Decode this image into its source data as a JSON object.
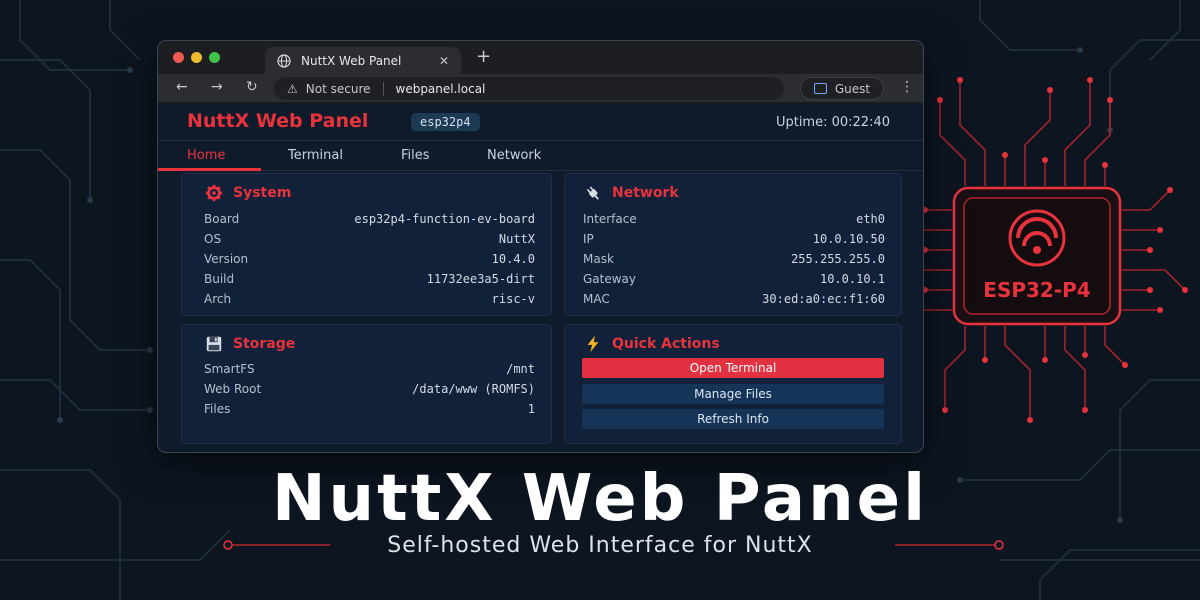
{
  "browser": {
    "tab_title": "NuttX Web Panel",
    "tab_close": "✕",
    "new_tab": "+",
    "nav": {
      "back": "←",
      "forward": "→",
      "reload": "↻"
    },
    "security_text": "Not secure",
    "url": "webpanel.local",
    "profile_label": "Guest",
    "menu": "⋮"
  },
  "app": {
    "title": "NuttX Web Panel",
    "board_chip": "esp32p4",
    "uptime": "Uptime: 00:22:40",
    "nav": [
      "Home",
      "Terminal",
      "Files",
      "Network"
    ],
    "active_nav": "Home"
  },
  "system": {
    "title": "System",
    "icon": "gear-icon",
    "rows": [
      {
        "k": "Board",
        "v": "esp32p4-function-ev-board"
      },
      {
        "k": "OS",
        "v": "NuttX"
      },
      {
        "k": "Version",
        "v": "10.4.0"
      },
      {
        "k": "Build",
        "v": "11732ee3a5-dirt"
      },
      {
        "k": "Arch",
        "v": "risc-v"
      }
    ]
  },
  "network": {
    "title": "Network",
    "icon": "plug-icon",
    "rows": [
      {
        "k": "Interface",
        "v": "eth0"
      },
      {
        "k": "IP",
        "v": "10.0.10.50"
      },
      {
        "k": "Mask",
        "v": "255.255.255.0"
      },
      {
        "k": "Gateway",
        "v": "10.0.10.1"
      },
      {
        "k": "MAC",
        "v": "30:ed:a0:ec:f1:60"
      }
    ]
  },
  "storage": {
    "title": "Storage",
    "icon": "floppy-disk-icon",
    "rows": [
      {
        "k": "SmartFS",
        "v": "/mnt"
      },
      {
        "k": "Web Root",
        "v": "/data/www (ROMFS)"
      },
      {
        "k": "Files",
        "v": "1"
      }
    ]
  },
  "quick_actions": {
    "title": "Quick Actions",
    "icon": "lightning-icon",
    "buttons": [
      "Open Terminal",
      "Manage Files",
      "Refresh Info"
    ]
  },
  "hero": {
    "title": "NuttX Web Panel",
    "subtitle": "Self-hosted Web Interface for NuttX",
    "chip_label": "ESP32-P4"
  },
  "colors": {
    "accent": "#e8333c",
    "background": "#0d1520",
    "card": "#12213a"
  }
}
